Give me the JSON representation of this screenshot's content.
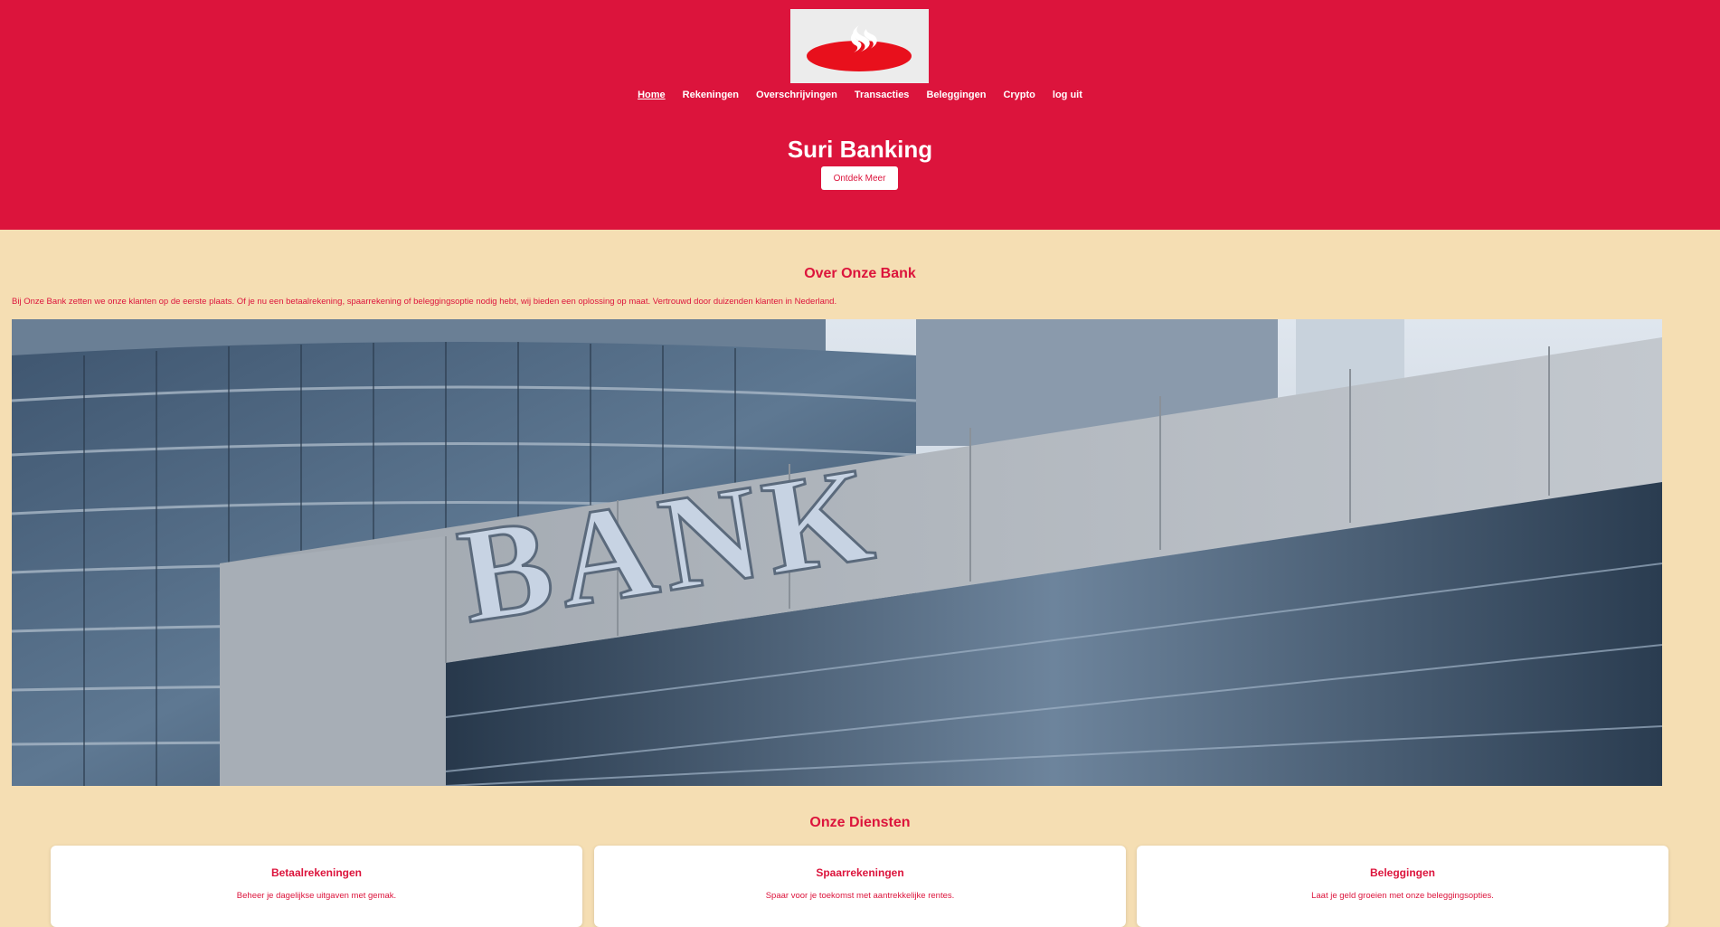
{
  "header": {
    "logo_icon": "santander-flame-logo",
    "nav": [
      {
        "label": "Home",
        "active": true
      },
      {
        "label": "Rekeningen",
        "active": false
      },
      {
        "label": "Overschrijvingen",
        "active": false
      },
      {
        "label": "Transacties",
        "active": false
      },
      {
        "label": "Beleggingen",
        "active": false
      },
      {
        "label": "Crypto",
        "active": false
      },
      {
        "label": "log uit",
        "active": false
      }
    ],
    "title": "Suri Banking",
    "cta_label": "Ontdek Meer"
  },
  "about": {
    "title": "Over Onze Bank",
    "text": "Bij Onze Bank zetten we onze klanten op de eerste plaats. Of je nu een betaalrekening, spaarrekening of beleggingsoptie nodig hebt, wij bieden een oplossing op maat. Vertrouwd door duizenden klanten in Nederland.",
    "image_sign": "BANK"
  },
  "services": {
    "title": "Onze Diensten",
    "cards": [
      {
        "title": "Betaalrekeningen",
        "text": "Beheer je dagelijkse uitgaven met gemak."
      },
      {
        "title": "Spaarrekeningen",
        "text": "Spaar voor je toekomst met aantrekkelijke rentes."
      },
      {
        "title": "Beleggingen",
        "text": "Laat je geld groeien met onze beleggingsopties."
      }
    ]
  },
  "colors": {
    "brand_red": "#dc143c",
    "page_background": "#f5deb3",
    "card_background": "#ffffff"
  }
}
